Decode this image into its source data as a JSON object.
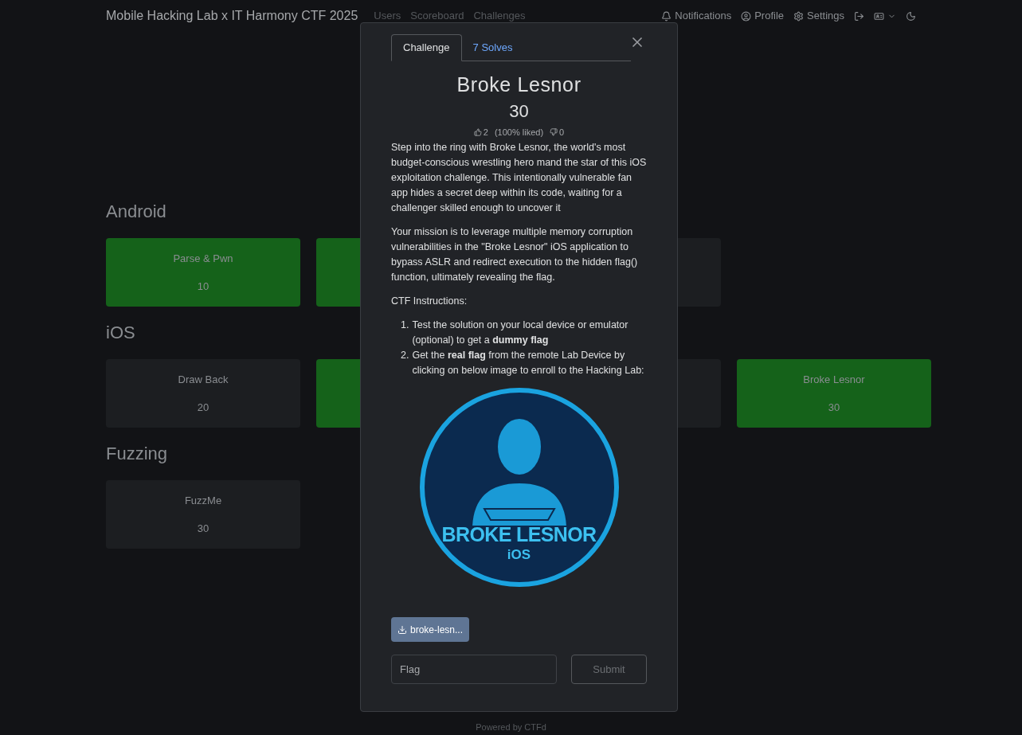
{
  "navbar": {
    "brand": "Mobile Hacking Lab x IT Harmony CTF 2025",
    "links": [
      "Users",
      "Scoreboard",
      "Challenges"
    ],
    "right": [
      {
        "kind": "notifications",
        "label": "Notifications"
      },
      {
        "kind": "profile",
        "label": "Profile"
      },
      {
        "kind": "settings",
        "label": "Settings"
      },
      {
        "kind": "logout"
      },
      {
        "kind": "language"
      },
      {
        "kind": "theme"
      }
    ]
  },
  "categories": [
    {
      "title": "Android",
      "cards": [
        {
          "name": "Parse & Pwn",
          "value": "10",
          "solved": true
        },
        {
          "solved": true
        },
        {
          "solved": false
        }
      ]
    },
    {
      "title": "iOS",
      "cards": [
        {
          "name": "Draw Back",
          "value": "20",
          "solved": false
        },
        {
          "solved": true
        },
        {
          "solved": false
        },
        {
          "name": "Broke Lesnor",
          "value": "30",
          "solved": true
        }
      ]
    },
    {
      "title": "Fuzzing",
      "cards": [
        {
          "name": "FuzzMe",
          "value": "30",
          "solved": false
        }
      ]
    }
  ],
  "modal": {
    "tabs": [
      {
        "label": "Challenge",
        "selected": true
      },
      {
        "label": "7 Solves",
        "selected": false
      }
    ],
    "name": "Broke Lesnor",
    "value": "30",
    "likes": "2",
    "liked": "(100% liked)",
    "dislikes": "0",
    "paragraphs": [
      "Step into the ring with Broke Lesnor, the world's most budget-conscious wrestling hero mand the star of this iOS exploitation challenge. This intentionally vulnerable fan app hides a secret deep within its code, waiting for a challenger skilled enough to uncover it",
      "Your mission is to leverage multiple memory corruption vulnerabilities in the \"Broke Lesnor\" iOS application to bypass ASLR and redirect execution to the hidden flag() function, ultimately revealing the flag.",
      "CTF Instructions:"
    ],
    "steps": [
      {
        "number": "1.",
        "text": "Test the solution on your local device or emulator (optional) to get a **dummy flag**"
      },
      {
        "number": "2.",
        "text": "Get the **real flag** from the remote Lab Device by clicking on below image to enroll to the Hacking Lab:"
      }
    ],
    "badge": {
      "title": "BROKE LESNOR",
      "subtitle": "iOS"
    },
    "file": "broke-lesn...",
    "flag": {
      "placeholder": "Flag"
    },
    "submit": "Submit"
  },
  "footer": "Powered by CTFd"
}
